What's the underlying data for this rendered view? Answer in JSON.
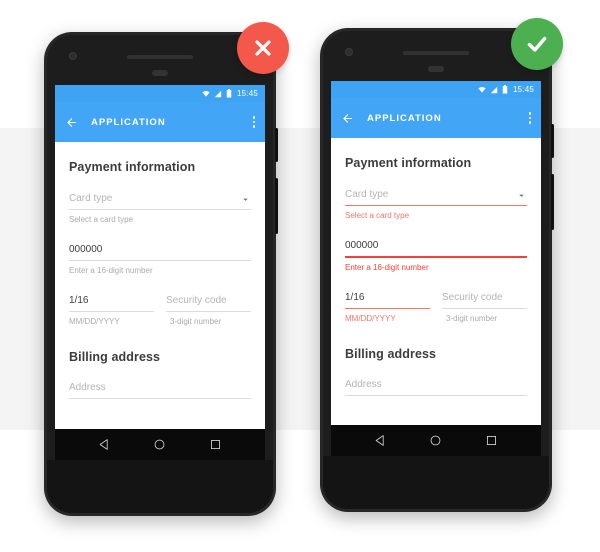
{
  "page": {
    "title": "Material Design text field error states comparison",
    "background_color": "#ffffff",
    "band_color": "#f4f4f4"
  },
  "colors": {
    "appbar": "#42a5f5",
    "statusbar": "#3fa3f3",
    "error": "#f44336",
    "error_light": "#f2776b",
    "fail_badge": "#f4584a",
    "success_badge": "#4caf50",
    "underline": "#dcdcdc",
    "text_primary": "#3c3c3c",
    "text_hint": "#b4b4b4",
    "helper": "#ababab"
  },
  "status_bar": {
    "time": "15:45",
    "icons": [
      "wifi-icon",
      "signal-icon",
      "battery-icon"
    ]
  },
  "app_bar": {
    "back_icon": "arrow-back-icon",
    "title": "APPLICATION",
    "overflow_icon": "overflow-menu-icon"
  },
  "nav_bar": {
    "back_icon": "nav-back-triangle-icon",
    "home_icon": "nav-home-circle-icon",
    "recents_icon": "nav-recents-square-icon"
  },
  "devices": [
    {
      "id": "dont",
      "badge": {
        "name": "fail-badge",
        "icon": "close-x-icon",
        "color": "#f4584a"
      },
      "form": {
        "heading": "Payment information",
        "fields": [
          {
            "name": "card-type",
            "value": "Card type",
            "is_placeholder": true,
            "helper": "Select a card type",
            "error": false,
            "has_chevron": true
          },
          {
            "name": "card-number",
            "value": "000000",
            "is_placeholder": false,
            "helper": "Enter a 16-digit number",
            "error": false,
            "has_chevron": false
          },
          {
            "name": "expiration-date",
            "value": "1/16",
            "is_placeholder": false,
            "helper": "MM/DD/YYYY",
            "error": false,
            "has_chevron": false
          },
          {
            "name": "security-code",
            "value": "Security code",
            "is_placeholder": true,
            "helper": "3-digit number",
            "error": false,
            "has_chevron": false
          }
        ],
        "billing_heading": "Billing address",
        "address": {
          "name": "address",
          "value": "Address",
          "is_placeholder": true
        }
      }
    },
    {
      "id": "do",
      "badge": {
        "name": "success-badge",
        "icon": "check-icon",
        "color": "#4caf50"
      },
      "form": {
        "heading": "Payment information",
        "fields": [
          {
            "name": "card-type",
            "value": "Card type",
            "is_placeholder": true,
            "helper": "Select a card type",
            "error": true,
            "error_strength": "light",
            "has_chevron": true
          },
          {
            "name": "card-number",
            "value": "000000",
            "is_placeholder": false,
            "helper": "Enter a 16-digit number",
            "error": true,
            "error_strength": "strong",
            "has_chevron": false
          },
          {
            "name": "expiration-date",
            "value": "1/16",
            "is_placeholder": false,
            "helper": "MM/DD/YYYY",
            "error": true,
            "error_strength": "light",
            "has_chevron": false
          },
          {
            "name": "security-code",
            "value": "Security code",
            "is_placeholder": true,
            "helper": "3-digit number",
            "error": false,
            "has_chevron": false
          }
        ],
        "billing_heading": "Billing address",
        "address": {
          "name": "address",
          "value": "Address",
          "is_placeholder": true
        }
      }
    }
  ]
}
